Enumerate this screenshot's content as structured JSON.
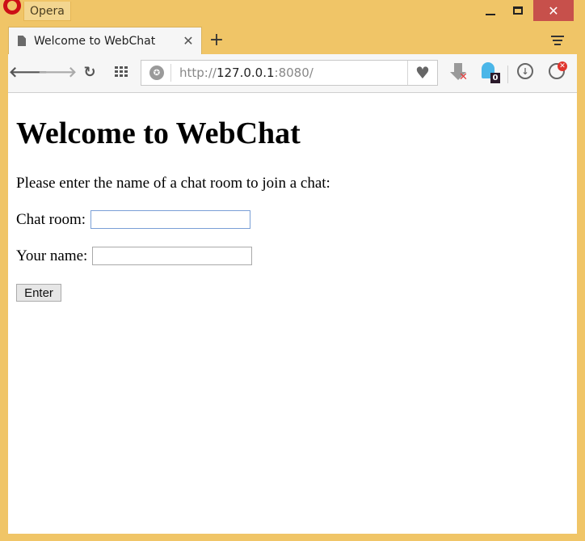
{
  "window": {
    "app_menu_label": "Opera",
    "minimize_icon": "minimize-icon",
    "maximize_icon": "maximize-icon",
    "close_icon": "close-icon",
    "close_color": "#c7504b",
    "frame_color": "#f0c567"
  },
  "tabs": [
    {
      "title": "Welcome to WebChat",
      "icon": "document-icon",
      "close_glyph": "✕"
    }
  ],
  "tabstrip": {
    "new_tab_glyph": "+",
    "menu_icon": "tab-menu-icon"
  },
  "toolbar": {
    "back_glyph": "🡐",
    "forward_glyph": "🡒",
    "reload_glyph": "↻",
    "speed_dial_icon": "grid-icon",
    "url": {
      "scheme": "http://",
      "host": "127.0.0.1",
      "port_path": ":8080/"
    },
    "bookmark_icon": "heart-icon",
    "extensions": [
      {
        "name": "download-blocked-icon"
      },
      {
        "name": "ghostery-icon",
        "badge": "0"
      },
      {
        "name": "downloads-icon"
      },
      {
        "name": "account-icon"
      }
    ]
  },
  "page": {
    "heading": "Welcome to WebChat",
    "intro": "Please enter the name of a chat room to join a chat:",
    "room_label": "Chat room:",
    "room_value": "",
    "name_label": "Your name:",
    "name_value": "",
    "enter_label": "Enter"
  }
}
